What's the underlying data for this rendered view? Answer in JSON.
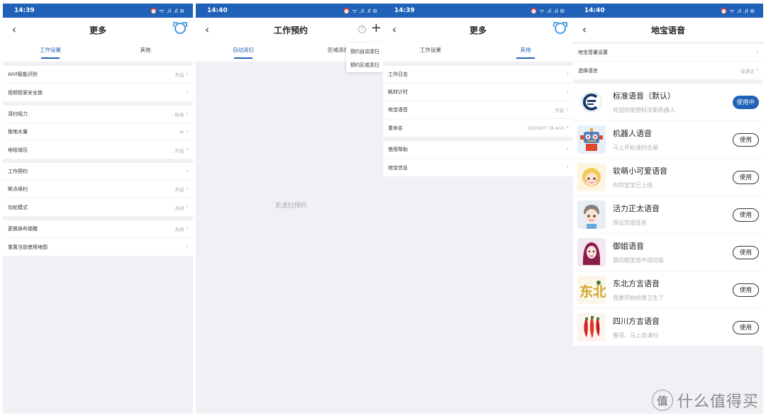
{
  "colors": {
    "primary": "#1f62b8",
    "background": "#f0f1f5",
    "muted": "#aaaaaa"
  },
  "screen1": {
    "status": {
      "time": "14:39",
      "icons": "⏰ ᯤ .ıl .ıl ⊖"
    },
    "title": "更多",
    "tabs": [
      "工作设置",
      "其他"
    ],
    "groups": [
      [
        {
          "label": "AIVI智能识别",
          "value": "开启"
        },
        {
          "label": "视频管家安全锁",
          "value": ""
        }
      ],
      [
        {
          "label": "清扫吸力",
          "value": "标准"
        },
        {
          "label": "拖地水量",
          "value": "中"
        },
        {
          "label": "地毯增压",
          "value": "开启"
        }
      ],
      [
        {
          "label": "工作预约",
          "value": ""
        },
        {
          "label": "断点续扫",
          "value": "开启"
        },
        {
          "label": "勿扰模式",
          "value": "关闭"
        }
      ],
      [
        {
          "label": "更换抹布提醒",
          "value": "关闭"
        },
        {
          "label": "重置当前使用地图",
          "value": ""
        }
      ]
    ]
  },
  "screen2": {
    "status": {
      "time": "14:40",
      "icons": "⏰ ᯤ .ıl .ıl ⊖"
    },
    "title": "工作预约",
    "tabs": [
      "自动清扫",
      "区域清扫"
    ],
    "empty": "无清扫预约",
    "menu": [
      "预约自动清扫",
      "预约区域清扫"
    ]
  },
  "screen3": {
    "status": {
      "time": "14:39",
      "icons": "⏰ ᯤ .ıl .ıl ⊖"
    },
    "title": "更多",
    "tabs": [
      "工作设置",
      "其他"
    ],
    "groups": [
      [
        {
          "label": "工作日志",
          "value": ""
        },
        {
          "label": "耗材计时",
          "value": ""
        },
        {
          "label": "地宝语音",
          "value": "开启"
        },
        {
          "label": "重命名",
          "value": "DEEBOT T8 AIVI"
        }
      ],
      [
        {
          "label": "使用帮助",
          "value": ""
        },
        {
          "label": "地宝信息",
          "value": ""
        }
      ]
    ]
  },
  "screen4": {
    "status": {
      "time": "14:40",
      "icons": "⏰ ᯤ .ıl .ıl ⊖"
    },
    "title": "地宝语音",
    "settings": [
      {
        "label": "地宝音量设置",
        "value": ""
      },
      {
        "label": "选择语言",
        "value": "普通话"
      }
    ],
    "use_label": "使用",
    "in_use_label": "使用中",
    "voices": [
      {
        "name": "标准语音（默认）",
        "desc": "欢迎您使用科沃斯机器人",
        "icon": "ecovacs-logo",
        "active": true
      },
      {
        "name": "机器人语音",
        "desc": "马上开始清扫全屋",
        "icon": "robot-avatar",
        "active": false
      },
      {
        "name": "软萌小可爱语音",
        "desc": "你的宝宝已上线",
        "icon": "cute-girl-avatar",
        "active": false
      },
      {
        "name": "活力正太语音",
        "desc": "保证完成任务",
        "icon": "boy-avatar",
        "active": false
      },
      {
        "name": "御姐语音",
        "desc": "我的眼里容不得垃圾",
        "icon": "lady-avatar",
        "active": false
      },
      {
        "name": "东北方言语音",
        "desc": "我要开始给擦卫生了",
        "icon": "dongbei-avatar",
        "active": false
      },
      {
        "name": "四川方言语音",
        "desc": "要得，马上去清扫",
        "icon": "chili-avatar",
        "active": false
      }
    ]
  },
  "watermark": {
    "text": "什么值得买",
    "logo_char": "值"
  }
}
